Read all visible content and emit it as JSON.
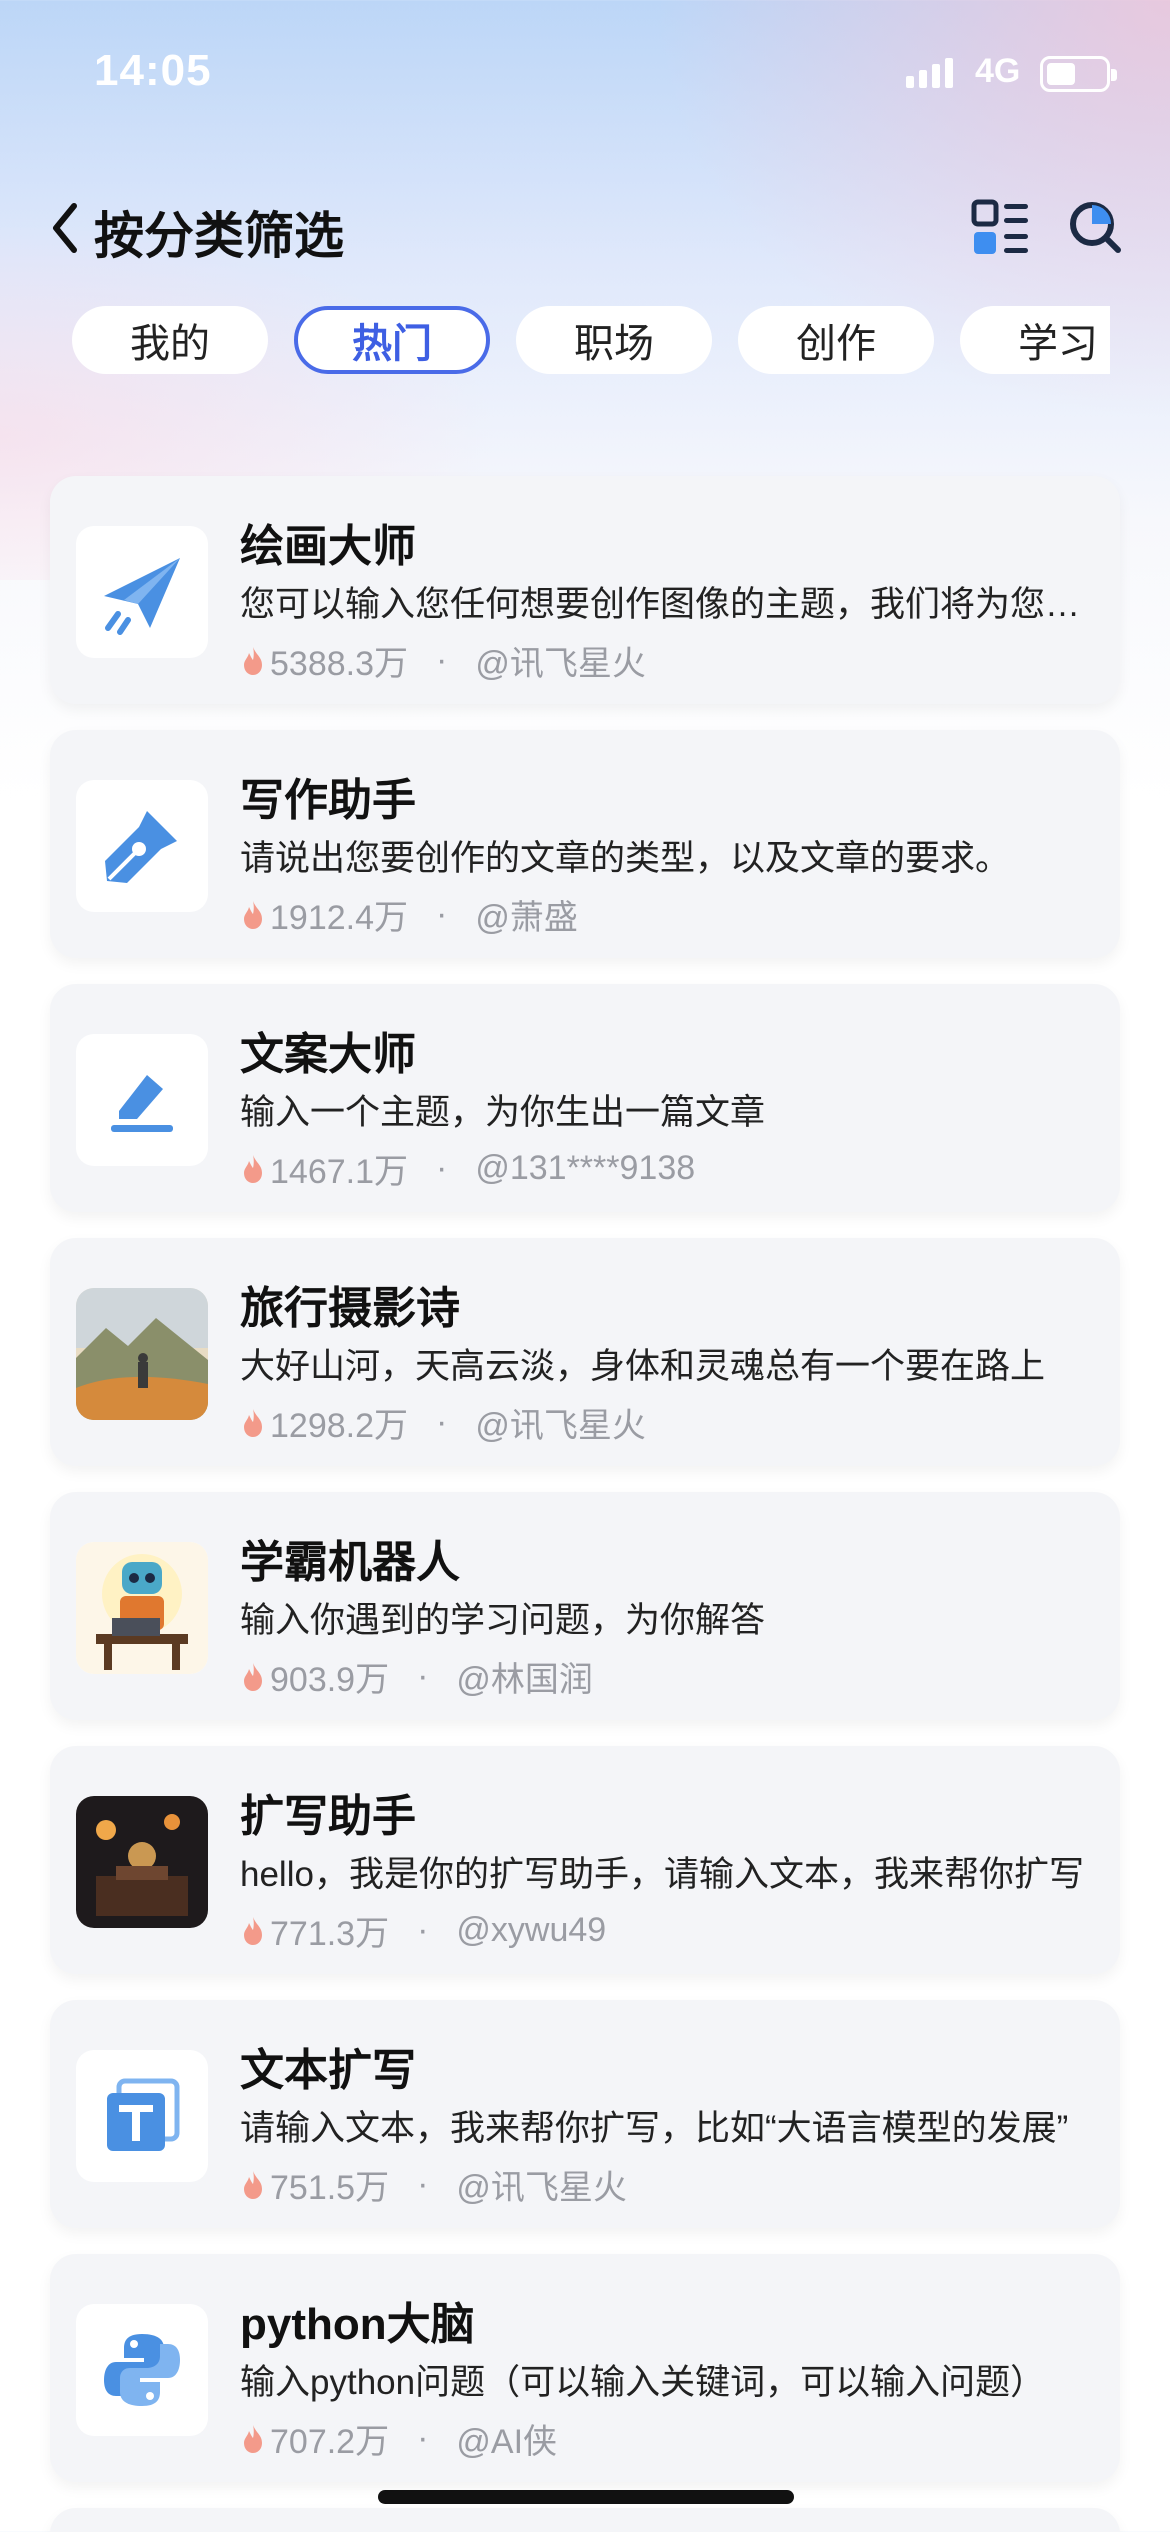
{
  "status_bar": {
    "time": "14:05",
    "network": "4G"
  },
  "header": {
    "title": "按分类筛选"
  },
  "tabs": [
    {
      "label": "我的",
      "active": false
    },
    {
      "label": "热门",
      "active": true
    },
    {
      "label": "职场",
      "active": false
    },
    {
      "label": "创作",
      "active": false
    },
    {
      "label": "学习",
      "active": false
    }
  ],
  "colors": {
    "accent": "#4a6be8",
    "icon_blue": "#4a90e2",
    "meta_gray": "#9a9ca3",
    "fire": "#f39a8a"
  },
  "cards": [
    {
      "icon": "paper-plane-icon",
      "title": "绘画大师",
      "desc": "您可以输入您任何想要创作图像的主题，我们将为您生成图像",
      "hot": "5388.3万",
      "author": "@讯飞星火"
    },
    {
      "icon": "fountain-pen-icon",
      "title": "写作助手",
      "desc": "请说出您要创作的文章的类型，以及文章的要求。",
      "hot": "1912.4万",
      "author": "@萧盛"
    },
    {
      "icon": "edit-icon",
      "title": "文案大师",
      "desc": "输入一个主题，为你生出一篇文章",
      "hot": "1467.1万",
      "author": "@131****9138"
    },
    {
      "icon": "mountain-photo-icon",
      "title": "旅行摄影诗",
      "desc": "大好山河，天高云淡，身体和灵魂总有一个要在路上",
      "hot": "1298.2万",
      "author": "@讯飞星火"
    },
    {
      "icon": "robot-icon",
      "title": "学霸机器人",
      "desc": "输入你遇到的学习问题，为你解答",
      "hot": "903.9万",
      "author": "@林国润"
    },
    {
      "icon": "night-scene-icon",
      "title": "扩写助手",
      "desc": "hello，我是你的扩写助手，请输入文本，我来帮你扩写",
      "hot": "771.3万",
      "author": "@xywu49"
    },
    {
      "icon": "text-t-icon",
      "title": "文本扩写",
      "desc": "请输入文本，我来帮你扩写，比如“大语言模型的发展”",
      "hot": "751.5万",
      "author": "@讯飞星火"
    },
    {
      "icon": "python-icon",
      "title": "python大脑",
      "desc": "输入python问题（可以输入关键词，可以输入问题）",
      "hot": "707.2万",
      "author": "@AI侠"
    }
  ]
}
